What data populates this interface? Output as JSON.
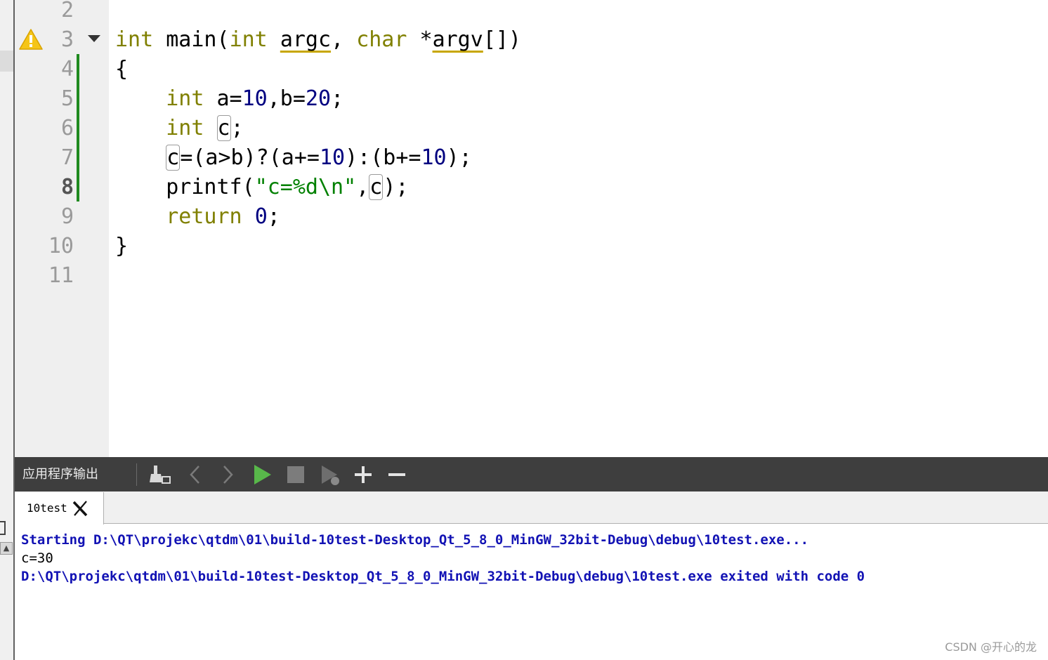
{
  "editor": {
    "line_numbers": [
      "2",
      "3",
      "4",
      "5",
      "6",
      "7",
      "8",
      "9",
      "10",
      "11"
    ],
    "current_line": "8",
    "lines": {
      "l3": {
        "kw_int": "int",
        "main": " main(",
        "kw_int2": "int",
        "sp1": " ",
        "argc": "argc",
        "comma": ", ",
        "kw_char": "char",
        "star": " *",
        "argv": "argv",
        "tail": "[])"
      },
      "l4": {
        "t": "{"
      },
      "l5": {
        "indent": "    ",
        "kw": "int",
        "a": " a=",
        "n1": "10",
        "b": ",b=",
        "n2": "20",
        "end": ";"
      },
      "l6": {
        "indent": "    ",
        "kw": "int",
        "sp": " ",
        "c": "c",
        "end": ";"
      },
      "l7": {
        "indent": "    ",
        "c": "c",
        "p1": "=(a>b)?(a+=",
        "n1": "10",
        "p2": "):(b+=",
        "n2": "10",
        "end": ");"
      },
      "l8": {
        "indent": "    ",
        "fn": "printf(",
        "str": "\"c=%d\\n\"",
        "comma": ",",
        "c": "c",
        "end": ");"
      },
      "l9": {
        "indent": "    ",
        "kw": "return",
        "sp": " ",
        "n": "0",
        "end": ";"
      },
      "l10": {
        "t": "}"
      }
    },
    "warning_icon": "warning-icon",
    "fold_icon": "fold-arrow-icon"
  },
  "output_pane": {
    "title": "应用程序输出",
    "tools": [
      "clean-output-icon",
      "previous-icon",
      "next-icon",
      "run-icon",
      "stop-icon",
      "attach-debugger-icon",
      "zoom-in-icon",
      "zoom-out-icon"
    ],
    "tab_label": "10test",
    "lines": [
      "Starting D:\\QT\\projekc\\qtdm\\01\\build-10test-Desktop_Qt_5_8_0_MinGW_32bit-Debug\\debug\\10test.exe...",
      "c=30",
      "D:\\QT\\projekc\\qtdm\\01\\build-10test-Desktop_Qt_5_8_0_MinGW_32bit-Debug\\debug\\10test.exe exited with code 0"
    ]
  },
  "watermark": "CSDN @开心的龙",
  "colors": {
    "keyword": "#808000",
    "number": "#000080",
    "string": "#008000",
    "output_info": "#1212b4",
    "change_bar": "#1f8a1f",
    "toolbar_bg": "#3e3e3e"
  }
}
